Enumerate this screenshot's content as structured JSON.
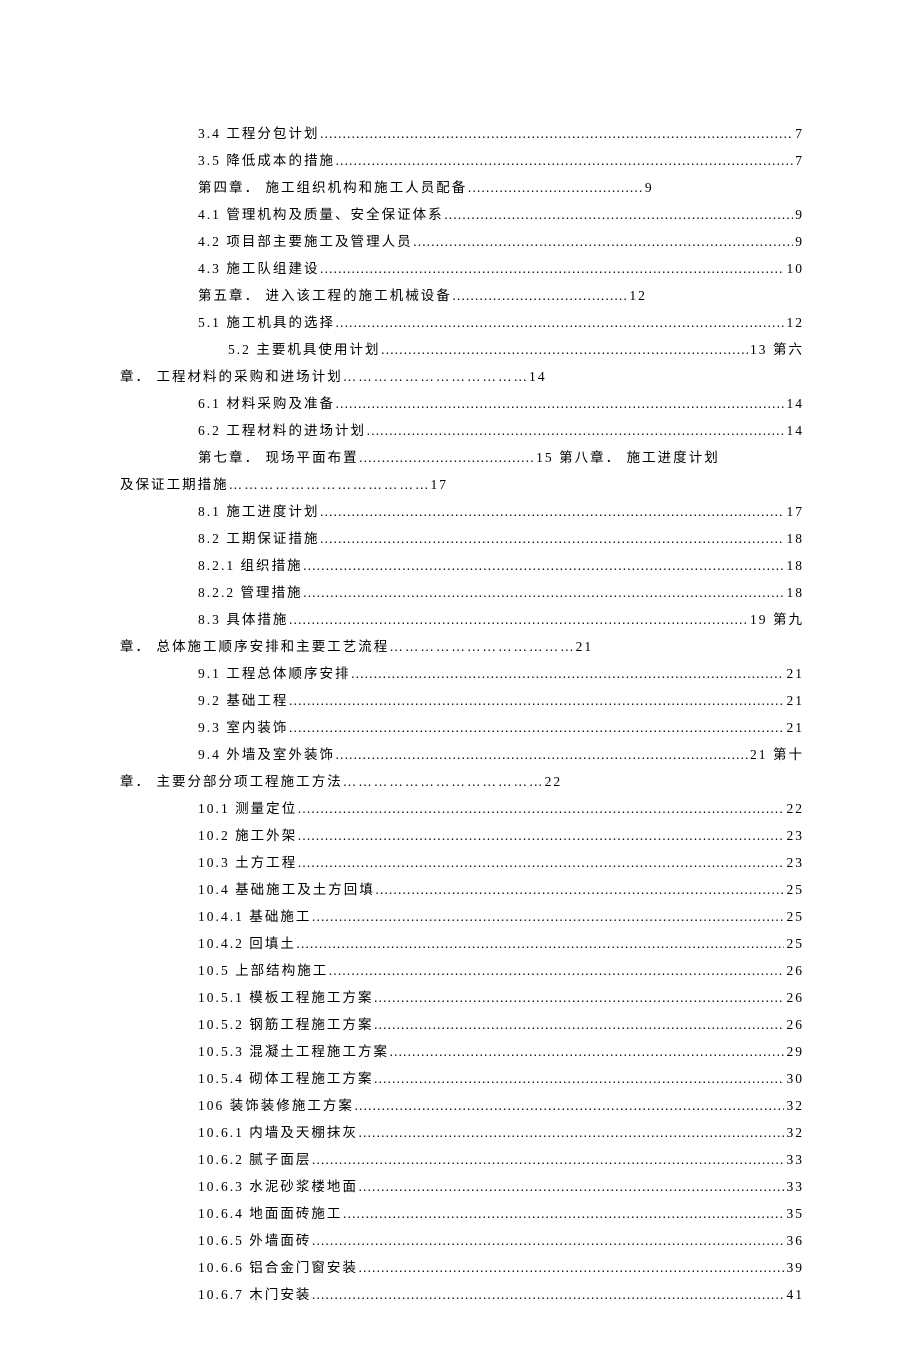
{
  "dots": "………………………………………………………………………………………………………………………………………………",
  "toc": [
    {
      "indent": 1,
      "title": "3.4 工程分包计划",
      "page": "7",
      "wrap": null
    },
    {
      "indent": 1,
      "title": "3.5 降低成本的措施",
      "page": "7",
      "wrap": null
    },
    {
      "indent": 1,
      "title": "第四章．  施工组织机构和施工人员配备",
      "page": "9",
      "wrap": null,
      "short": true
    },
    {
      "indent": 1,
      "title": "4.1 管理机构及质量、安全保证体系",
      "page": "9",
      "wrap": null
    },
    {
      "indent": 1,
      "title": "4.2  项目部主要施工及管理人员",
      "page": "9",
      "wrap": null
    },
    {
      "indent": 1,
      "title": "4.3  施工队组建设",
      "page": "10",
      "wrap": null
    },
    {
      "indent": 1,
      "title": "第五章．  进入该工程的施工机械设备",
      "page": "12",
      "wrap": null,
      "short": true
    },
    {
      "indent": 1,
      "title": "5.1  施工机具的选择",
      "page": "12",
      "wrap": null
    },
    {
      "indent": 2,
      "title": "5.2 主要机具使用计划",
      "page": "13 第六",
      "wrap": "章．  工程材料的采购和进场计划………………………………14"
    },
    {
      "indent": 1,
      "title": "6.1  材料采购及准备",
      "page": "14",
      "wrap": null
    },
    {
      "indent": 1,
      "title": "6.2 工程材料的进场计划",
      "page": "14",
      "wrap": null
    },
    {
      "indent": 1,
      "title": "第七章．  现场平面布置",
      "page": "15 第八章．  施工进度计划",
      "wrap": "及保证工期措施…………………………………17",
      "short": true
    },
    {
      "indent": 1,
      "title": "8.1 施工进度计划",
      "page": "17",
      "wrap": null
    },
    {
      "indent": 1,
      "title": "8.2 工期保证措施",
      "page": "18",
      "wrap": null
    },
    {
      "indent": 1,
      "title": "8.2.1 组织措施",
      "page": "18",
      "wrap": null
    },
    {
      "indent": 1,
      "title": "8.2.2 管理措施",
      "page": "18",
      "wrap": null
    },
    {
      "indent": 1,
      "title": "8.3 具体措施",
      "page": "19 第九",
      "wrap": "章．  总体施工顺序安排和主要工艺流程………………………………21"
    },
    {
      "indent": 1,
      "title": "9.1 工程总体顺序安排",
      "page": "21",
      "wrap": null
    },
    {
      "indent": 1,
      "title": "9.2 基础工程",
      "page": "21",
      "wrap": null
    },
    {
      "indent": 1,
      "title": "9.3 室内装饰",
      "page": "21",
      "wrap": null
    },
    {
      "indent": 1,
      "title": "9.4 外墙及室外装饰",
      "page": "21 第十",
      "wrap": "章．  主要分部分项工程施工方法…………………………………22"
    },
    {
      "indent": 1,
      "title": "10.1 测量定位",
      "page": "22",
      "wrap": null
    },
    {
      "indent": 1,
      "title": "10.2 施工外架",
      "page": "23",
      "wrap": null
    },
    {
      "indent": 1,
      "title": "10.3 土方工程",
      "page": "23",
      "wrap": null
    },
    {
      "indent": 1,
      "title": "10.4 基础施工及土方回填",
      "page": "25",
      "wrap": null
    },
    {
      "indent": 1,
      "title": "10.4.1 基础施工",
      "page": "25",
      "wrap": null
    },
    {
      "indent": 1,
      "title": "10.4.2 回填土",
      "page": "25",
      "wrap": null
    },
    {
      "indent": 1,
      "title": "10.5 上部结构施工",
      "page": "26",
      "wrap": null
    },
    {
      "indent": 1,
      "title": "10.5.1 模板工程施工方案",
      "page": "26",
      "wrap": null
    },
    {
      "indent": 1,
      "title": "10.5.2 钢筋工程施工方案",
      "page": "26",
      "wrap": null
    },
    {
      "indent": 1,
      "title": "10.5.3 混凝土工程施工方案",
      "page": "29",
      "wrap": null
    },
    {
      "indent": 1,
      "title": "10.5.4 砌体工程施工方案",
      "page": "30",
      "wrap": null
    },
    {
      "indent": 1,
      "title": "106 装饰装修施工方案",
      "page": "32",
      "wrap": null
    },
    {
      "indent": 1,
      "title": "10.6.1 内墙及天棚抹灰",
      "page": "32",
      "wrap": null
    },
    {
      "indent": 1,
      "title": "10.6.2 腻子面层",
      "page": "33",
      "wrap": null
    },
    {
      "indent": 1,
      "title": "10.6.3 水泥砂浆楼地面",
      "page": "33",
      "wrap": null
    },
    {
      "indent": 1,
      "title": "10.6.4 地面面砖施工",
      "page": "35",
      "wrap": null
    },
    {
      "indent": 1,
      "title": "10.6.5 外墙面砖",
      "page": "36",
      "wrap": null
    },
    {
      "indent": 1,
      "title": "10.6.6 铝合金门窗安装",
      "page": "39",
      "wrap": null
    },
    {
      "indent": 1,
      "title": "10.6.7 木门安装",
      "page": "41",
      "wrap": null
    }
  ]
}
